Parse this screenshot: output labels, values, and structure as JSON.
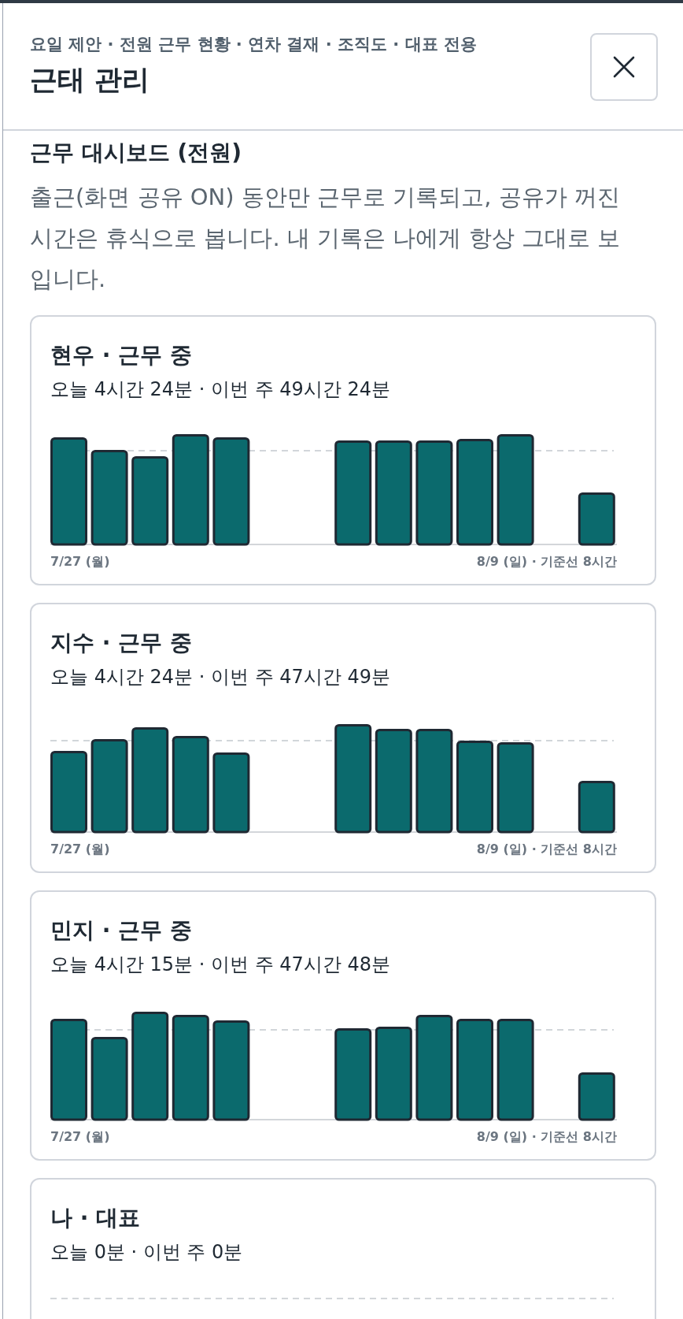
{
  "header": {
    "subtitle": "요일 제안 · 전원 근무 현황 · 연차 결재 · 조직도 · 대표 전용",
    "title": "근태 관리"
  },
  "section": {
    "heading": "근무 대시보드 (전원)",
    "description": "출근(화면 공유 ON) 동안만 근무로 기록되고, 공유가 꺼진 시간은 휴식으로 봅니다. 내 기록은 나에게 항상 그대로 보입니다."
  },
  "cards": [
    {
      "title": "현우 · 근무 중",
      "summary": "오늘 4시간 24분 · 이번 주 49시간 24분",
      "start_label": "7/27 (월)",
      "end_label": "8/9 (일) · 기준선 8시간"
    },
    {
      "title": "지수 · 근무 중",
      "summary": "오늘 4시간 24분 · 이번 주 47시간 49분",
      "start_label": "7/27 (월)",
      "end_label": "8/9 (일) · 기준선 8시간"
    },
    {
      "title": "민지 · 근무 중",
      "summary": "오늘 4시간 15분 · 이번 주 47시간 48분",
      "start_label": "7/27 (월)",
      "end_label": "8/9 (일) · 기준선 8시간"
    },
    {
      "title": "나 · 대표",
      "summary": "오늘 0분 · 이번 주 0분"
    }
  ]
}
